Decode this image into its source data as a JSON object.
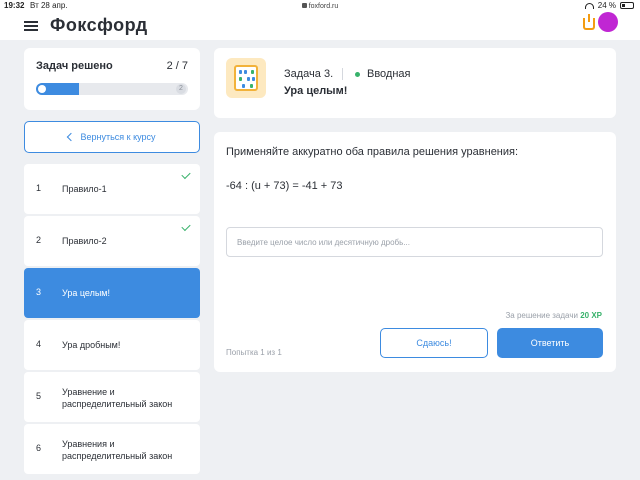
{
  "statusbar": {
    "time": "19:32",
    "date": "Вт 28 апр.",
    "url": "foxford.ru",
    "battery": "24 %"
  },
  "header": {
    "logo": "Фоксфорд"
  },
  "progress": {
    "title": "Задач решено",
    "count": "2 / 7",
    "fraction": 0.2857,
    "end_marker": "2"
  },
  "back_button": {
    "label": "Вернуться к курсу"
  },
  "tasks": [
    {
      "num": "1",
      "label": "Правило-1",
      "done": true
    },
    {
      "num": "2",
      "label": "Правило-2",
      "done": true
    },
    {
      "num": "3",
      "label": "Ура целым!",
      "active": true
    },
    {
      "num": "4",
      "label": "Ура дробным!"
    },
    {
      "num": "5",
      "label": "Уравнение и распределительный закон"
    },
    {
      "num": "6",
      "label": "Уравнения и распределительный закон"
    }
  ],
  "task": {
    "number": "Задача 3.",
    "type": "Вводная",
    "title": "Ура целым!"
  },
  "problem": {
    "instruction": "Применяйте аккуратно оба правила решения уравнения:",
    "equation": "-64 : (u + 73) = -41 + 73",
    "input_placeholder": "Введите целое число или десятичную дробь...",
    "input_value": "",
    "reward_text": "За решение задачи",
    "reward_xp": "20 XP",
    "attempt": "Попытка 1 из 1",
    "giveup_label": "Сдаюсь!",
    "answer_label": "Ответить"
  },
  "colors": {
    "accent": "#3d8be0",
    "success": "#38b26b",
    "background": "#eef0f3"
  }
}
